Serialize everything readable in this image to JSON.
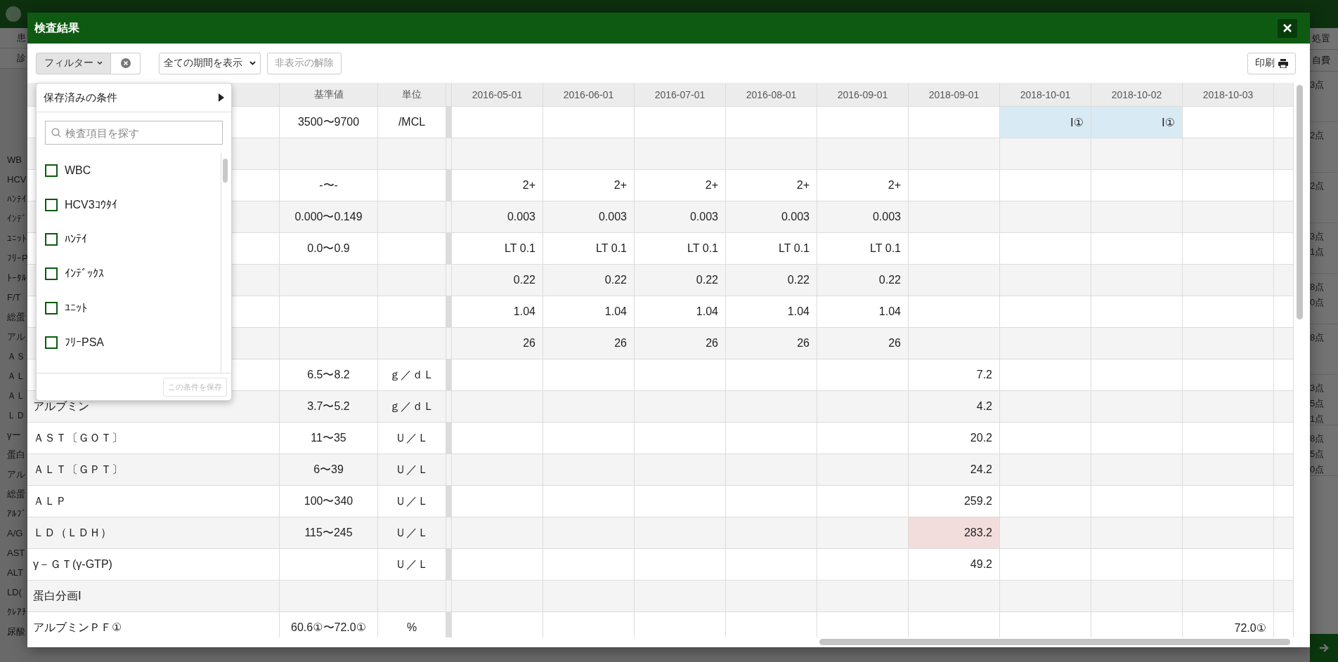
{
  "backdrop": {
    "header_labels": [
      "患",
      "診"
    ],
    "side_labels": [
      "処置",
      "自費"
    ],
    "left_fragments": [
      "WB",
      "HCV",
      "ﾊﾝﾃｲ",
      "ｲﾝﾃﾞ",
      "ﾕﾆｯﾄ",
      "ﾌﾘｰP",
      "ﾄｰﾀﾙ",
      "F/T",
      "総蛋",
      "アル",
      "ＡＳ",
      "ＡＬ",
      "ＡＬ",
      "ＬＤ",
      "γー",
      "蛋白",
      "アル",
      "総蛋",
      "ｱﾙﾌﾞ",
      "A/G",
      "AST",
      "ALT",
      "LD(",
      "ｸﾚｱﾁ",
      "尿酸"
    ],
    "points_groups": [
      [
        "3点"
      ],
      [
        "2点"
      ],
      [
        "2点"
      ],
      [
        "3点",
        "1点"
      ],
      [
        "8点",
        "0点"
      ],
      [
        "8点"
      ],
      [
        "3点",
        "5点",
        "1点"
      ],
      [
        "8点",
        "5点",
        "0点"
      ]
    ]
  },
  "dialog": {
    "title": "検査結果"
  },
  "toolbar": {
    "filter_button": "フィルター",
    "period_select": "全ての期間を表示",
    "unhide_button": {
      "label": "非表示の解除",
      "disabled": true
    },
    "print_button": "印刷"
  },
  "filter_menu": {
    "saved_conditions": "保存済みの条件",
    "search": {
      "placeholder": "検査項目を探す"
    },
    "items": [
      {
        "label": "WBC",
        "checked": false
      },
      {
        "label": "HCV3ｺｳﾀｲ",
        "checked": false
      },
      {
        "label": "ﾊﾝﾃｲ",
        "checked": false
      },
      {
        "label": "ｲﾝﾃﾞｯｸｽ",
        "checked": false
      },
      {
        "label": "ﾕﾆｯﾄ",
        "checked": false
      },
      {
        "label": "ﾌﾘｰPSA",
        "checked": false
      }
    ],
    "save_button": {
      "label": "この条件を保存",
      "disabled": true
    }
  },
  "table": {
    "columns": [
      "基準値",
      "単位"
    ],
    "dates": [
      "2016-05-01",
      "2016-06-01",
      "2016-07-01",
      "2016-08-01",
      "2016-09-01",
      "2018-09-01",
      "2018-10-01",
      "2018-10-02",
      "2018-10-03"
    ],
    "rows": [
      {
        "reference": "3500〜9700",
        "unit": "/MCL",
        "values": [
          {
            "kind": "empty"
          },
          {
            "kind": "empty"
          },
          {
            "kind": "empty"
          },
          {
            "kind": "empty"
          },
          {
            "kind": "empty"
          },
          {
            "kind": "empty"
          },
          {
            "kind": "value",
            "text": "Ⅰ①",
            "marked": true,
            "abnormal": false
          },
          {
            "kind": "value",
            "text": "Ⅰ①",
            "marked": true,
            "abnormal": false
          },
          {
            "kind": "empty"
          }
        ]
      },
      {
        "values": [
          {
            "kind": "empty"
          },
          {
            "kind": "empty"
          },
          {
            "kind": "empty"
          },
          {
            "kind": "empty"
          },
          {
            "kind": "empty"
          },
          {
            "kind": "empty"
          },
          {
            "kind": "empty"
          },
          {
            "kind": "empty"
          },
          {
            "kind": "empty"
          }
        ]
      },
      {
        "reference": "-〜-",
        "values": [
          {
            "kind": "value",
            "text": "2+",
            "marked": false,
            "abnormal": false
          },
          {
            "kind": "value",
            "text": "2+",
            "marked": false,
            "abnormal": false
          },
          {
            "kind": "value",
            "text": "2+",
            "marked": false,
            "abnormal": false
          },
          {
            "kind": "value",
            "text": "2+",
            "marked": false,
            "abnormal": false
          },
          {
            "kind": "value",
            "text": "2+",
            "marked": false,
            "abnormal": false
          },
          {
            "kind": "empty"
          },
          {
            "kind": "empty"
          },
          {
            "kind": "empty"
          },
          {
            "kind": "empty"
          }
        ]
      },
      {
        "reference": "0.000〜0.149",
        "values": [
          {
            "kind": "value",
            "text": "0.003",
            "marked": false,
            "abnormal": false
          },
          {
            "kind": "value",
            "text": "0.003",
            "marked": false,
            "abnormal": false
          },
          {
            "kind": "value",
            "text": "0.003",
            "marked": false,
            "abnormal": false
          },
          {
            "kind": "value",
            "text": "0.003",
            "marked": false,
            "abnormal": false
          },
          {
            "kind": "value",
            "text": "0.003",
            "marked": false,
            "abnormal": false
          },
          {
            "kind": "empty"
          },
          {
            "kind": "empty"
          },
          {
            "kind": "empty"
          },
          {
            "kind": "empty"
          }
        ]
      },
      {
        "reference": "0.0〜0.9",
        "values": [
          {
            "kind": "value",
            "text": "LT 0.1",
            "marked": false,
            "abnormal": false
          },
          {
            "kind": "value",
            "text": "LT 0.1",
            "marked": false,
            "abnormal": false
          },
          {
            "kind": "value",
            "text": "LT 0.1",
            "marked": false,
            "abnormal": false
          },
          {
            "kind": "value",
            "text": "LT 0.1",
            "marked": false,
            "abnormal": false
          },
          {
            "kind": "value",
            "text": "LT 0.1",
            "marked": false,
            "abnormal": false
          },
          {
            "kind": "empty"
          },
          {
            "kind": "empty"
          },
          {
            "kind": "empty"
          },
          {
            "kind": "empty"
          }
        ]
      },
      {
        "values": [
          {
            "kind": "value",
            "text": "0.22",
            "marked": false,
            "abnormal": false
          },
          {
            "kind": "value",
            "text": "0.22",
            "marked": false,
            "abnormal": false
          },
          {
            "kind": "value",
            "text": "0.22",
            "marked": false,
            "abnormal": false
          },
          {
            "kind": "value",
            "text": "0.22",
            "marked": false,
            "abnormal": false
          },
          {
            "kind": "value",
            "text": "0.22",
            "marked": false,
            "abnormal": false
          },
          {
            "kind": "empty"
          },
          {
            "kind": "empty"
          },
          {
            "kind": "empty"
          },
          {
            "kind": "empty"
          }
        ]
      },
      {
        "values": [
          {
            "kind": "value",
            "text": "1.04",
            "marked": false,
            "abnormal": false
          },
          {
            "kind": "value",
            "text": "1.04",
            "marked": false,
            "abnormal": false
          },
          {
            "kind": "value",
            "text": "1.04",
            "marked": false,
            "abnormal": false
          },
          {
            "kind": "value",
            "text": "1.04",
            "marked": false,
            "abnormal": false
          },
          {
            "kind": "value",
            "text": "1.04",
            "marked": false,
            "abnormal": false
          },
          {
            "kind": "empty"
          },
          {
            "kind": "empty"
          },
          {
            "kind": "empty"
          },
          {
            "kind": "empty"
          }
        ]
      },
      {
        "values": [
          {
            "kind": "value",
            "text": "26",
            "marked": false,
            "abnormal": false
          },
          {
            "kind": "value",
            "text": "26",
            "marked": false,
            "abnormal": false
          },
          {
            "kind": "value",
            "text": "26",
            "marked": false,
            "abnormal": false
          },
          {
            "kind": "value",
            "text": "26",
            "marked": false,
            "abnormal": false
          },
          {
            "kind": "value",
            "text": "26",
            "marked": false,
            "abnormal": false
          },
          {
            "kind": "empty"
          },
          {
            "kind": "empty"
          },
          {
            "kind": "empty"
          },
          {
            "kind": "empty"
          }
        ]
      },
      {
        "reference": "6.5〜8.2",
        "unit": "ｇ／ｄＬ",
        "values": [
          {
            "kind": "empty"
          },
          {
            "kind": "empty"
          },
          {
            "kind": "empty"
          },
          {
            "kind": "empty"
          },
          {
            "kind": "empty"
          },
          {
            "kind": "value",
            "text": "7.2",
            "marked": false,
            "abnormal": false
          },
          {
            "kind": "empty"
          },
          {
            "kind": "empty"
          },
          {
            "kind": "empty"
          }
        ]
      },
      {
        "name": "アルブミン",
        "reference": "3.7〜5.2",
        "unit": "ｇ／ｄＬ",
        "values": [
          {
            "kind": "empty"
          },
          {
            "kind": "empty"
          },
          {
            "kind": "empty"
          },
          {
            "kind": "empty"
          },
          {
            "kind": "empty"
          },
          {
            "kind": "value",
            "text": "4.2",
            "marked": false,
            "abnormal": false
          },
          {
            "kind": "empty"
          },
          {
            "kind": "empty"
          },
          {
            "kind": "empty"
          }
        ]
      },
      {
        "name": "ＡＳＴ〔ＧＯＴ〕",
        "reference": "11〜35",
        "unit": "Ｕ／Ｌ",
        "values": [
          {
            "kind": "empty"
          },
          {
            "kind": "empty"
          },
          {
            "kind": "empty"
          },
          {
            "kind": "empty"
          },
          {
            "kind": "empty"
          },
          {
            "kind": "value",
            "text": "20.2",
            "marked": false,
            "abnormal": false
          },
          {
            "kind": "empty"
          },
          {
            "kind": "empty"
          },
          {
            "kind": "empty"
          }
        ]
      },
      {
        "name": "ＡＬＴ〔ＧＰＴ〕",
        "reference": "6〜39",
        "unit": "Ｕ／Ｌ",
        "values": [
          {
            "kind": "empty"
          },
          {
            "kind": "empty"
          },
          {
            "kind": "empty"
          },
          {
            "kind": "empty"
          },
          {
            "kind": "empty"
          },
          {
            "kind": "value",
            "text": "24.2",
            "marked": false,
            "abnormal": false
          },
          {
            "kind": "empty"
          },
          {
            "kind": "empty"
          },
          {
            "kind": "empty"
          }
        ]
      },
      {
        "name": "ＡＬＰ",
        "reference": "100〜340",
        "unit": "Ｕ／Ｌ",
        "values": [
          {
            "kind": "empty"
          },
          {
            "kind": "empty"
          },
          {
            "kind": "empty"
          },
          {
            "kind": "empty"
          },
          {
            "kind": "empty"
          },
          {
            "kind": "value",
            "text": "259.2",
            "marked": false,
            "abnormal": false
          },
          {
            "kind": "empty"
          },
          {
            "kind": "empty"
          },
          {
            "kind": "empty"
          }
        ]
      },
      {
        "name": "ＬＤ（ＬＤＨ）",
        "reference": "115〜245",
        "unit": "Ｕ／Ｌ",
        "values": [
          {
            "kind": "empty"
          },
          {
            "kind": "empty"
          },
          {
            "kind": "empty"
          },
          {
            "kind": "empty"
          },
          {
            "kind": "empty"
          },
          {
            "kind": "value",
            "text": "283.2",
            "marked": false,
            "abnormal": true
          },
          {
            "kind": "empty"
          },
          {
            "kind": "empty"
          },
          {
            "kind": "empty"
          }
        ]
      },
      {
        "name": "γ－ＧＴ(γ-GTP)",
        "unit": "Ｕ／Ｌ",
        "values": [
          {
            "kind": "empty"
          },
          {
            "kind": "empty"
          },
          {
            "kind": "empty"
          },
          {
            "kind": "empty"
          },
          {
            "kind": "empty"
          },
          {
            "kind": "value",
            "text": "49.2",
            "marked": false,
            "abnormal": false
          },
          {
            "kind": "empty"
          },
          {
            "kind": "empty"
          },
          {
            "kind": "empty"
          }
        ]
      },
      {
        "name": "蛋白分画Ⅰ",
        "values": [
          {
            "kind": "empty"
          },
          {
            "kind": "empty"
          },
          {
            "kind": "empty"
          },
          {
            "kind": "empty"
          },
          {
            "kind": "empty"
          },
          {
            "kind": "empty"
          },
          {
            "kind": "empty"
          },
          {
            "kind": "empty"
          },
          {
            "kind": "empty"
          }
        ]
      },
      {
        "name": "アルブミンＰＦ①",
        "reference": "60.6①〜72.0①",
        "unit": "%",
        "values": [
          {
            "kind": "empty"
          },
          {
            "kind": "empty"
          },
          {
            "kind": "empty"
          },
          {
            "kind": "empty"
          },
          {
            "kind": "empty"
          },
          {
            "kind": "empty"
          },
          {
            "kind": "empty"
          },
          {
            "kind": "empty"
          },
          {
            "kind": "value",
            "text": "72.0①",
            "marked": false,
            "abnormal": false
          }
        ]
      }
    ]
  }
}
